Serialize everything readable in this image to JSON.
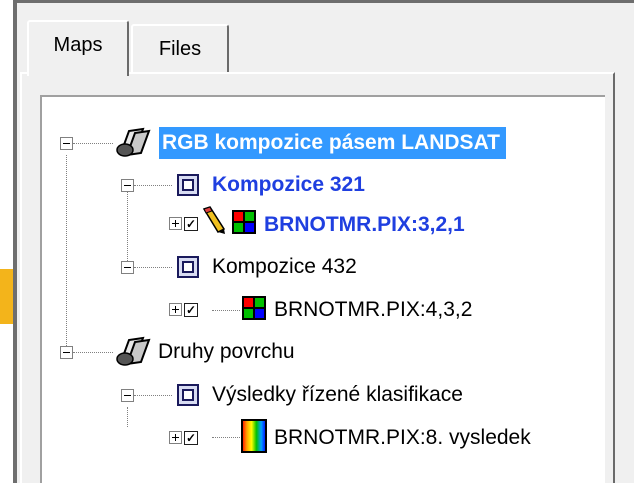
{
  "tabs": [
    {
      "label": "Maps"
    },
    {
      "label": "Files"
    }
  ],
  "tree": {
    "items": [
      {
        "label": "RGB kompozice pásem LANDSAT"
      },
      {
        "label": "Kompozice 321"
      },
      {
        "label": "BRNOTMR.PIX:3,2,1"
      },
      {
        "label": "Kompozice 432"
      },
      {
        "label": "BRNOTMR.PIX:4,3,2"
      },
      {
        "label": "Druhy povrchu"
      },
      {
        "label": "Výsledky řízené klasifikace"
      },
      {
        "label": "BRNOTMR.PIX:8. vysledek"
      }
    ]
  },
  "colors": {
    "selection": "#3399ff",
    "active_label": "#1f3fe0",
    "accent": "#f3b41b"
  },
  "icons": [
    "map-book-icon",
    "composition-icon",
    "pencil-icon",
    "rgb-channels-icon",
    "spectrum-icon"
  ]
}
